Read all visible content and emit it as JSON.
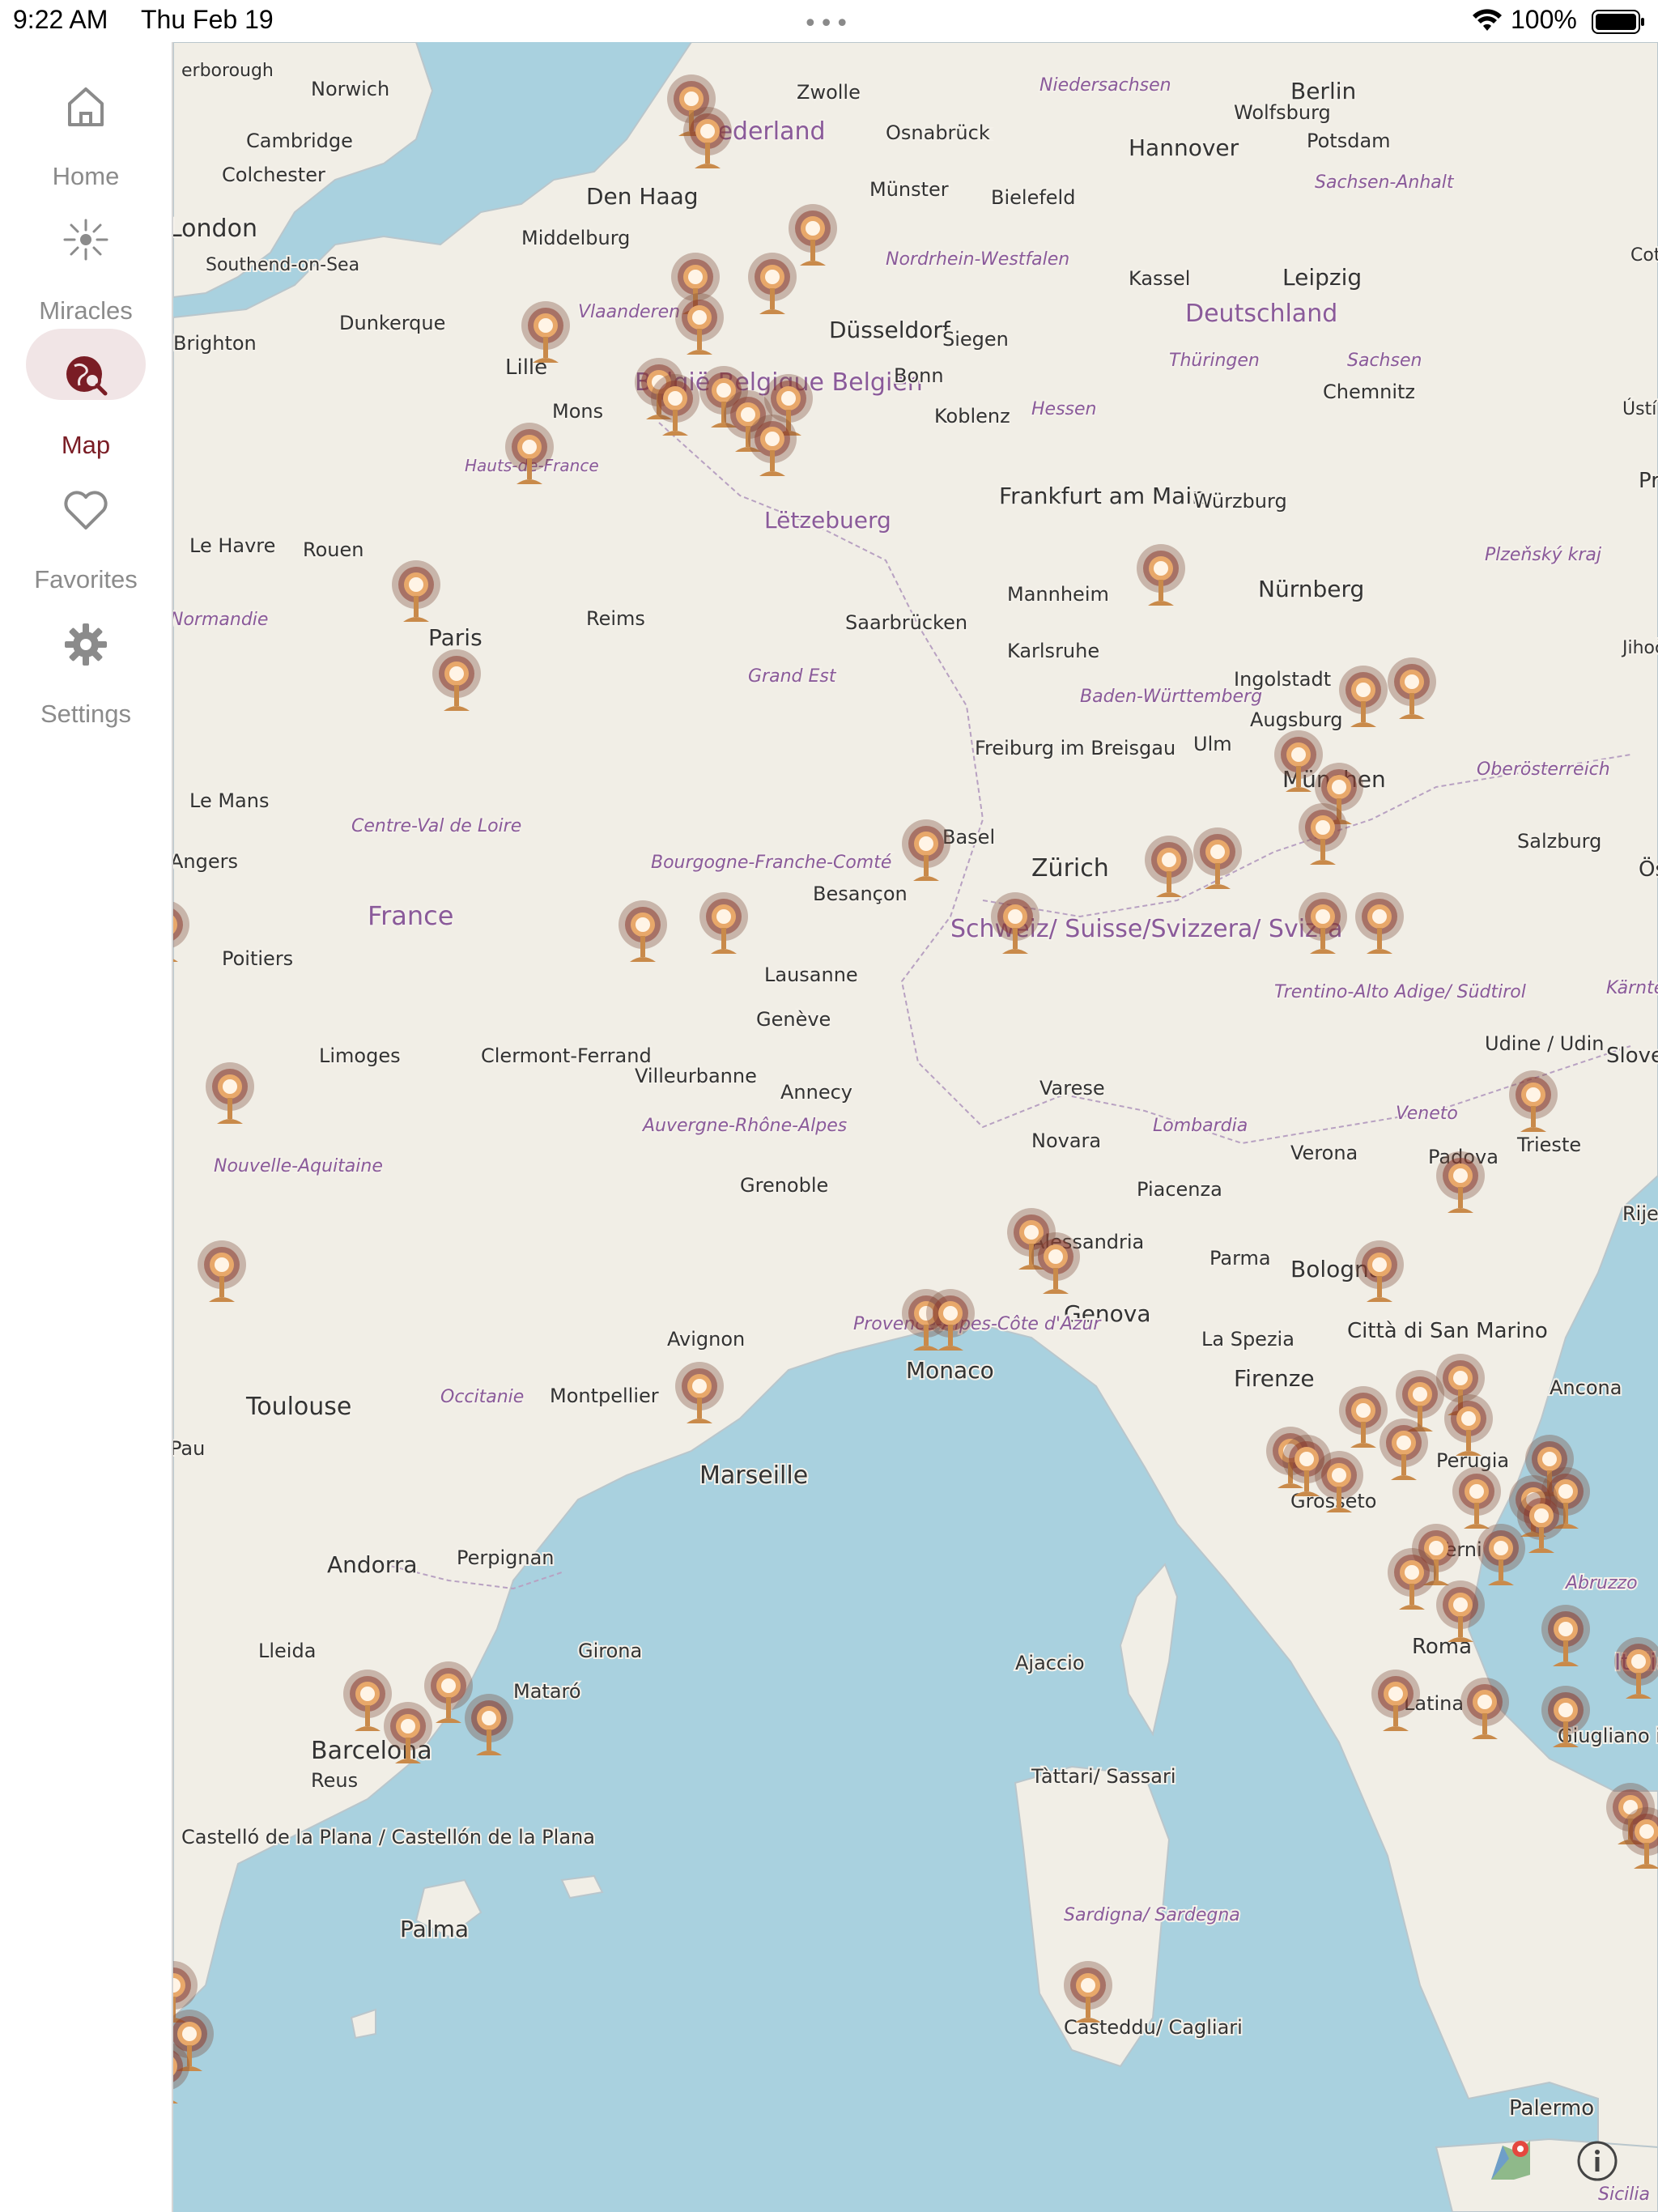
{
  "status_bar": {
    "time": "9:22 AM",
    "date": "Thu Feb 19",
    "battery": "100%"
  },
  "sidebar": {
    "items": [
      {
        "label": "Home",
        "icon": "home-icon"
      },
      {
        "label": "Miracles",
        "icon": "monstrance-icon"
      },
      {
        "label": "Map",
        "icon": "map-search-icon",
        "active": true
      },
      {
        "label": "Favorites",
        "icon": "heart-icon"
      },
      {
        "label": "Settings",
        "icon": "gear-icon"
      }
    ]
  },
  "colors": {
    "accent": "#7a1d25",
    "sea": "#a9d1df",
    "land": "#f1eee6",
    "marker": "#c98a4a"
  },
  "map": {
    "labels": [
      "erborough",
      "Norwich",
      "Cambridge",
      "Colchester",
      "London",
      "Southend-on-Sea",
      "Brighton",
      "Dunkerque",
      "Lille",
      "Mons",
      "Hauts-de-France",
      "Le Havre",
      "Rouen",
      "Normandie",
      "Paris",
      "Reims",
      "Le Mans",
      "Centre-Val de Loire",
      "Angers",
      "France",
      "Poitiers",
      "Limoges",
      "Nouvelle-Aquitaine",
      "Clermont-Ferrand",
      "Villeurbanne",
      "Auvergne-Rhône-Alpes",
      "Grenoble",
      "Annecy",
      "Genève",
      "Lausanne",
      "Besançon",
      "Bourgogne-Franche-Comté",
      "Grand Est",
      "Saarbrücken",
      "Lëtzebuerg",
      "Den Haag",
      "Nederland",
      "Middelburg",
      "Vlaanderen",
      "België Belgique Belgien",
      "Zwolle",
      "Osnabrück",
      "Münster",
      "Bielefeld",
      "Niedersachsen",
      "Wolfsburg",
      "Hannover",
      "Berlin",
      "Potsdam",
      "Sachsen-Anhalt",
      "Leipzig",
      "Deutschland",
      "Düsseldorf",
      "Nordrhein-Westfalen",
      "Kassel",
      "Siegen",
      "Bonn",
      "Koblenz",
      "Hessen",
      "Frankfurt am Main",
      "Würzburg",
      "Thüringen",
      "Sachsen",
      "Chemnitz",
      "Mannheim",
      "Karlsruhe",
      "Nürnberg",
      "Baden-Württemberg",
      "Ingolstadt",
      "Augsburg",
      "Ulm",
      "München",
      "Freiburg im Breisgau",
      "Basel",
      "Zürich",
      "Schweiz/ Suisse/Svizzera/ Svizra",
      "Salzburg",
      "Oberösterreich",
      "Plzeňský kraj",
      "Trentino-Alto Adige/ Südtirol",
      "Udine / Udin",
      "Trieste",
      "Padova",
      "Veneto",
      "Verona",
      "Lombardia",
      "Varese",
      "Novara",
      "Piacenza",
      "Alessandria",
      "Parma",
      "Bologna",
      "Genova",
      "La Spezia",
      "Firenze",
      "Città di San Marino",
      "Ancona",
      "Perugia",
      "Grosseto",
      "Terni",
      "Roma",
      "Latina",
      "Italia",
      "Abruzzo",
      "Monaco",
      "Provence-Alpes-Côte d'Azur",
      "Avignon",
      "Marseille",
      "Montpellier",
      "Occitanie",
      "Toulouse",
      "Andorra",
      "Perpignan",
      "Girona",
      "Lleida",
      "Mataró",
      "Barcelona",
      "Reus",
      "Castelló de la Plana / Castellón de la Plana",
      "Palma",
      "Ajaccio",
      "Tàttari/ Sassari",
      "Sardigna/ Sardegna",
      "Casteddu/ Cagliari",
      "Palermo",
      "Giugliano in Campania",
      "Kärnten",
      "Slove",
      "Rijek",
      "Praha",
      "Ústí Labe",
      "Cottbus Chóśeb",
      "Sicilia",
      "Jihoč",
      "Öste",
      "Pau"
    ]
  }
}
